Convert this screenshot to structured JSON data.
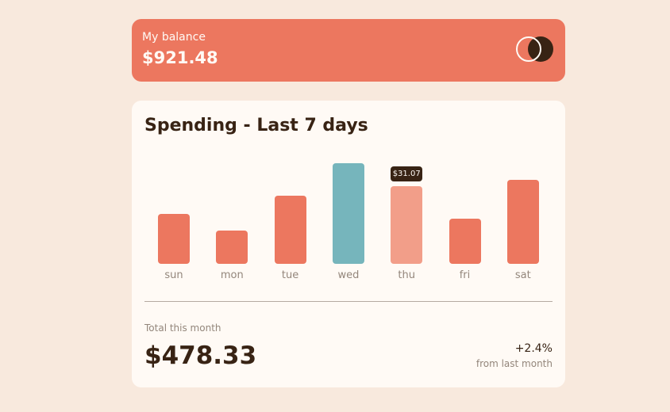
{
  "balance": {
    "label": "My balance",
    "amount": "$921.48"
  },
  "spending": {
    "title": "Spending - Last 7 days",
    "tooltip": "$31.07"
  },
  "chart_data": {
    "type": "bar",
    "categories": [
      "sun",
      "mon",
      "tue",
      "wed",
      "thu",
      "fri",
      "sat"
    ],
    "values": [
      17.45,
      11.7,
      23.6,
      35.0,
      27.0,
      15.8,
      29.2
    ],
    "highlighted_index": 3,
    "hovered_index": 4,
    "hover_label": "$31.07",
    "colors": {
      "default": "#ec775f",
      "highlight": "#76b5bc",
      "hover": "#f29e89"
    }
  },
  "summary": {
    "total_label": "Total this month",
    "total_amount": "$478.33",
    "change_pct": "+2.4%",
    "change_label": "from last month"
  }
}
